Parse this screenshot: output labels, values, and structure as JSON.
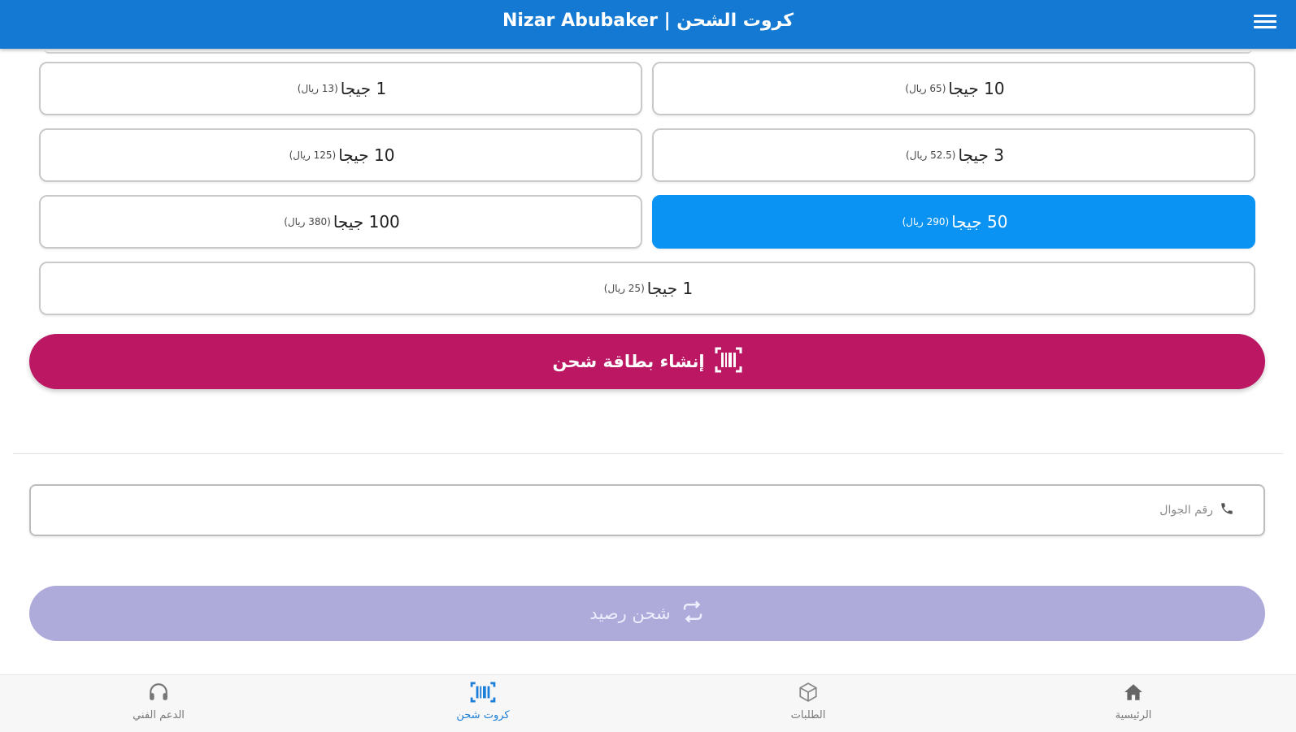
{
  "appbar": {
    "title": "Nizar Abubaker | كروت الشحن",
    "menu_icon": "hamburger-menu-icon"
  },
  "packages": [
    {
      "label": "10 جيجا",
      "price": "(65 ريال)",
      "selected": false
    },
    {
      "label": "1 جيجا",
      "price": "(13 ريال)",
      "selected": false
    },
    {
      "label": "3 جيجا",
      "price": "(52.5 ريال)",
      "selected": false
    },
    {
      "label": "10 جيجا",
      "price": "(125 ريال)",
      "selected": false
    },
    {
      "label": "50 جيجا",
      "price": "(290 ريال)",
      "selected": true
    },
    {
      "label": "100 جيجا",
      "price": "(380 ريال)",
      "selected": false
    },
    {
      "label": "1 جيجا",
      "price": "(25 ريال)",
      "selected": false
    }
  ],
  "create_card": {
    "label": "إنشاء بطاقة شحن",
    "icon": "barcode-icon",
    "color": "#bb1763"
  },
  "phone": {
    "placeholder": "رقم الجوال",
    "value": "",
    "icon": "phone-icon"
  },
  "topup": {
    "label": "شحن رصيد",
    "icon": "repeat-icon",
    "color": "#aeaad9"
  },
  "nav": [
    {
      "label": "الدعم الفني",
      "icon": "headphones-icon",
      "active": false
    },
    {
      "label": "كروت شحن",
      "icon": "barcode-icon",
      "active": true
    },
    {
      "label": "الطلبات",
      "icon": "box-icon",
      "active": false
    },
    {
      "label": "الرئيسية",
      "icon": "home-icon",
      "active": false
    }
  ],
  "colors": {
    "primary": "#1479d2",
    "selected": "#0a93f2",
    "accent": "#bb1763",
    "disabled": "#aeaad9"
  }
}
